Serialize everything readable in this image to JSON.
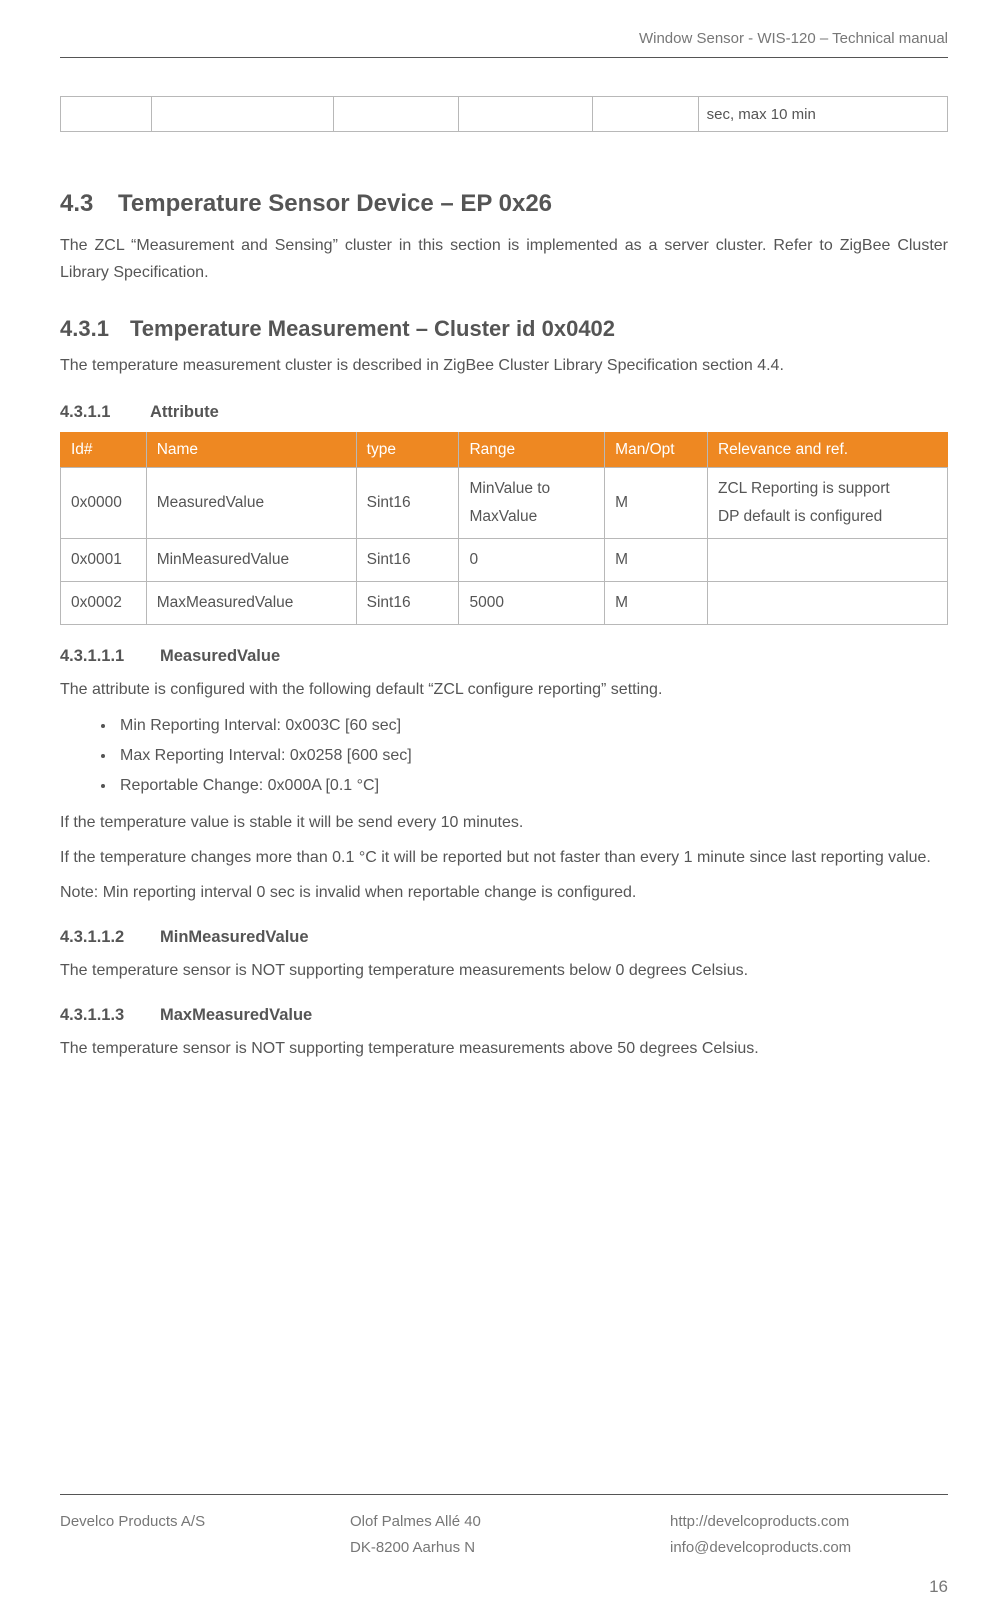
{
  "header": {
    "title": "Window Sensor - WIS-120 – Technical manual"
  },
  "frag_table": {
    "cols": 6,
    "last_cell": "sec, max 10 min"
  },
  "sec43": {
    "no": "4.3",
    "title": "Temperature Sensor Device – EP 0x26",
    "para": "The ZCL “Measurement and Sensing” cluster in this section is implemented as a server cluster. Refer to ZigBee Cluster Library Specification."
  },
  "sec431": {
    "no": "4.3.1",
    "title": "Temperature Measurement – Cluster id 0x0402",
    "para": "The temperature measurement cluster is described in ZigBee Cluster Library Specification section 4.4."
  },
  "sec4311": {
    "no": "4.3.1.1",
    "title": "Attribute"
  },
  "attr_table": {
    "headers": [
      "Id#",
      "Name",
      "type",
      "Range",
      "Man/Opt",
      "Relevance and ref."
    ],
    "rows": [
      {
        "id": "0x0000",
        "name": "MeasuredValue",
        "type": "Sint16",
        "range_l1": "MinValue to",
        "range_l2": "MaxValue",
        "man": "M",
        "rel_l1": "ZCL Reporting is support",
        "rel_l2": "DP default is configured"
      },
      {
        "id": "0x0001",
        "name": "MinMeasuredValue",
        "type": "Sint16",
        "range": "0",
        "man": "M",
        "rel": ""
      },
      {
        "id": "0x0002",
        "name": "MaxMeasuredValue",
        "type": "Sint16",
        "range": "5000",
        "man": "M",
        "rel": ""
      }
    ]
  },
  "sec43111": {
    "no": "4.3.1.1.1",
    "title": "MeasuredValue",
    "intro": "The attribute is configured with the following default “ZCL configure reporting” setting.",
    "bullets": [
      "Min Reporting Interval: 0x003C [60 sec]",
      "Max Reporting Interval: 0x0258 [600 sec]",
      "Reportable Change: 0x000A [0.1 °C]"
    ],
    "after1": "If the temperature value is stable it will be send every 10 minutes.",
    "after2": "If the temperature changes more than 0.1 °C it will be reported but not faster than every 1 minute since last reporting value.",
    "after3": "Note: Min reporting interval 0 sec is invalid when reportable change is configured."
  },
  "sec43112": {
    "no": "4.3.1.1.2",
    "title": "MinMeasuredValue",
    "para": "The temperature sensor is NOT supporting temperature measurements below 0 degrees Celsius."
  },
  "sec43113": {
    "no": "4.3.1.1.3",
    "title": "MaxMeasuredValue",
    "para": "The temperature sensor is NOT supporting temperature measurements above 50 degrees Celsius."
  },
  "footer": {
    "company": "Develco Products A/S",
    "addr1": "Olof Palmes Allé 40",
    "addr2": "DK-8200 Aarhus N",
    "url": "http://develcoproducts.com",
    "mail": "info@develcoproducts.com",
    "page": "16"
  }
}
